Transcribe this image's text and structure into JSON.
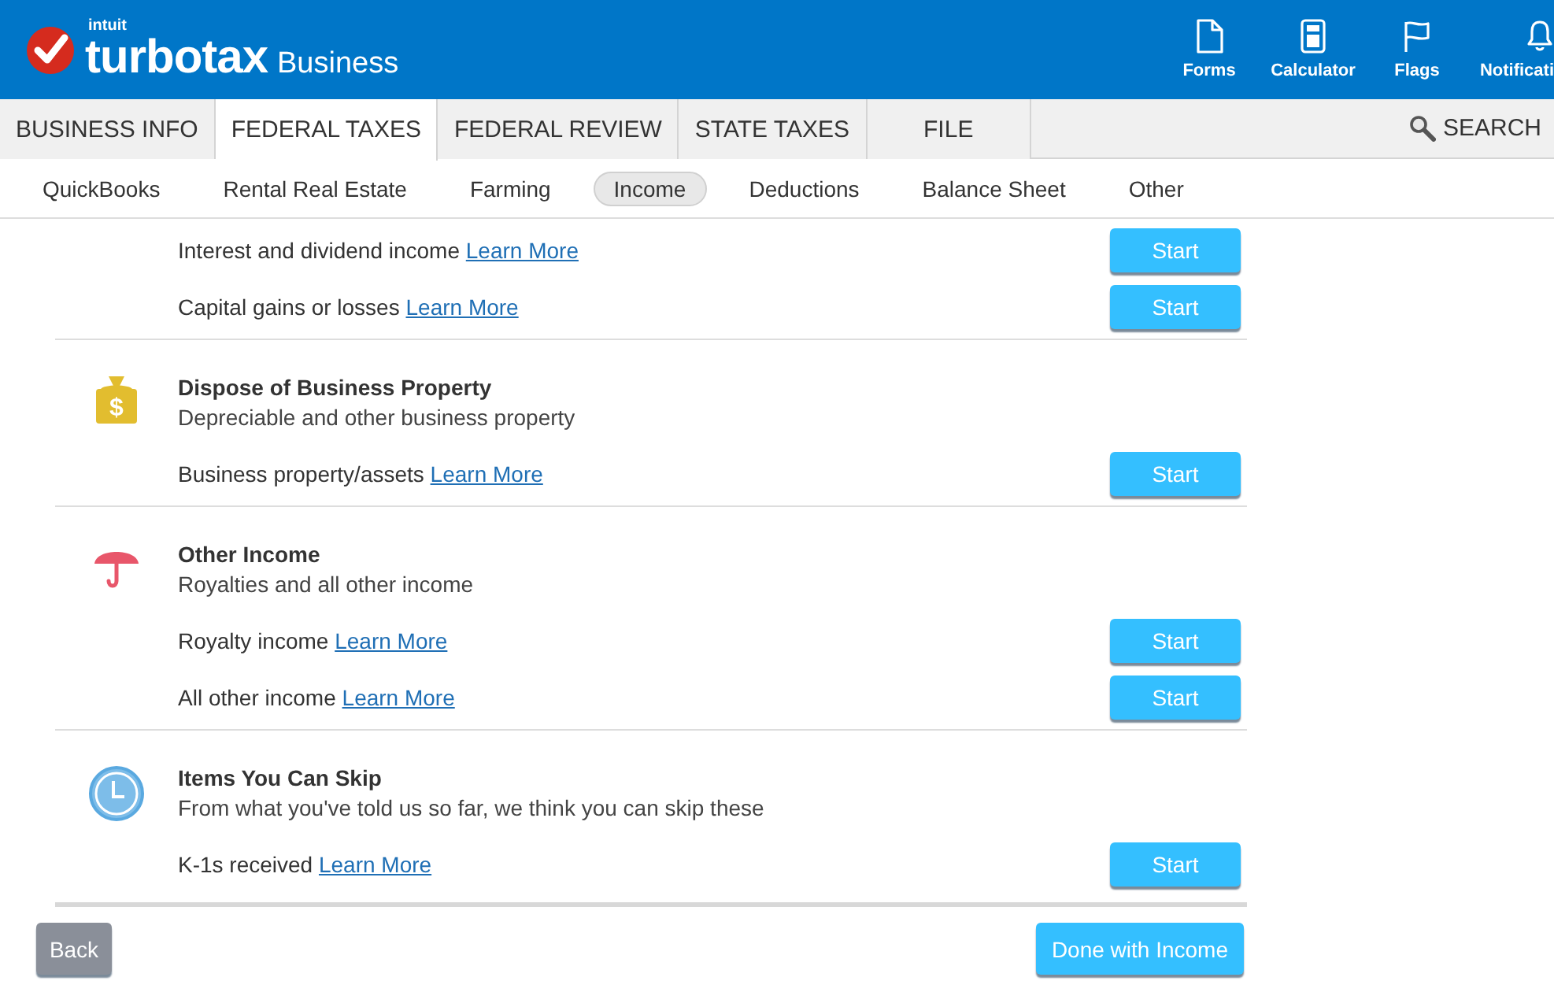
{
  "header": {
    "logo": {
      "maker": "intuit",
      "brand": "turbotax",
      "product": "Business"
    },
    "tools": [
      {
        "kind": "forms",
        "label": "Forms"
      },
      {
        "kind": "calculator",
        "label": "Calculator"
      },
      {
        "kind": "flags",
        "label": "Flags"
      },
      {
        "kind": "notifications",
        "label": "Notificati"
      }
    ]
  },
  "tabs": [
    {
      "label": "BUSINESS INFO",
      "selected": false
    },
    {
      "label": "FEDERAL TAXES",
      "selected": true
    },
    {
      "label": "FEDERAL REVIEW",
      "selected": false
    },
    {
      "label": "STATE TAXES",
      "selected": false
    },
    {
      "label": "FILE",
      "selected": false
    }
  ],
  "search": {
    "label": "SEARCH"
  },
  "subnav": [
    {
      "label": "QuickBooks",
      "selected": false
    },
    {
      "label": "Rental Real Estate",
      "selected": false
    },
    {
      "label": "Farming",
      "selected": false
    },
    {
      "label": "Income",
      "selected": true
    },
    {
      "label": "Deductions",
      "selected": false
    },
    {
      "label": "Balance Sheet",
      "selected": false
    },
    {
      "label": "Other",
      "selected": false
    }
  ],
  "sections": [
    {
      "rows": [
        {
          "label": "Interest and dividend income",
          "link": "Learn More",
          "button": "Start"
        },
        {
          "label": "Capital gains or losses",
          "link": "Learn More",
          "button": "Start"
        }
      ]
    },
    {
      "kind": "money-bag",
      "icon_label": "$",
      "title": "Dispose of Business Property",
      "subtitle": "Depreciable and other business property",
      "rows": [
        {
          "label": "Business property/assets",
          "link": "Learn More",
          "button": "Start"
        }
      ]
    },
    {
      "kind": "umbrella",
      "title": "Other Income",
      "subtitle": "Royalties and all other income",
      "rows": [
        {
          "label": "Royalty income",
          "link": "Learn More",
          "button": "Start"
        },
        {
          "label": "All other income",
          "link": "Learn More",
          "button": "Start"
        }
      ]
    },
    {
      "kind": "clock",
      "title": "Items You Can Skip",
      "subtitle": "From what you've told us so far, we think you can skip these",
      "rows": [
        {
          "label": "K-1s received",
          "link": "Learn More",
          "button": "Start"
        }
      ]
    }
  ],
  "footer": {
    "back": "Back",
    "done": "Done with Income"
  }
}
